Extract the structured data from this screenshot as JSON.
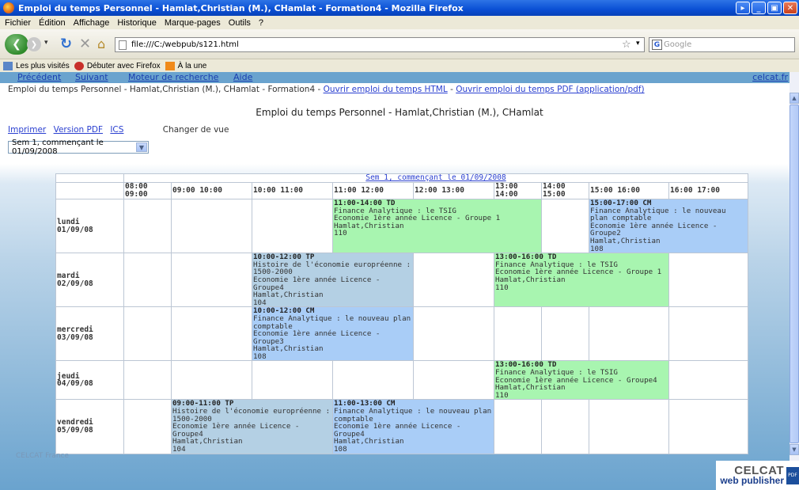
{
  "window": {
    "title": "Emploi du temps Personnel - Hamlat,Christian (M.), CHamlat - Formation4 - Mozilla Firefox"
  },
  "menu": [
    "Fichier",
    "Édition",
    "Affichage",
    "Historique",
    "Marque-pages",
    "Outils",
    "?"
  ],
  "toolbar": {
    "url": "file:///C:/webpub/s121.html",
    "search_placeholder": "Google"
  },
  "bookmarks": [
    "Les plus visités",
    "Débuter avec Firefox",
    "À la une"
  ],
  "topnav": {
    "prev": "Précédent",
    "next": "Suivant",
    "search": "Moteur de recherche",
    "help": "Aide",
    "site": "celcat.fr"
  },
  "breadcrumb": {
    "text": "Emploi du temps Personnel - Hamlat,Christian (M.), CHamlat - Formation4 - ",
    "link_html": "Ouvrir emploi du temps HTML",
    "sep": " - ",
    "link_pdf": "Ouvrir emploi du temps PDF (application/pdf)"
  },
  "page_title": "Emploi du temps Personnel - Hamlat,Christian (M.), CHamlat",
  "actions": {
    "print": "Imprimer",
    "pdf": "Version PDF",
    "ics": "ICS",
    "change_view": "Changer de vue"
  },
  "week_select": "Sem 1, commençant le 01/09/2008",
  "footer": "CELCAT France",
  "logo": {
    "line1": "CELCAT",
    "line2": "web publisher",
    "pdf": "PDF"
  },
  "timetable": {
    "week_label": "Sem 1, commençant le 01/09/2008",
    "headers": [
      "08:00 09:00",
      "09:00 10:00",
      "10:00 11:00",
      "11:00 12:00",
      "12:00 13:00",
      "13:00 14:00",
      "14:00 15:00",
      "15:00 16:00",
      "16:00 17:00"
    ],
    "days": [
      {
        "name": "lundi",
        "date": "01/09/08"
      },
      {
        "name": "mardi",
        "date": "02/09/08"
      },
      {
        "name": "mercredi",
        "date": "03/09/08"
      },
      {
        "name": "jeudi",
        "date": "04/09/08"
      },
      {
        "name": "vendredi",
        "date": "05/09/08"
      }
    ],
    "events": {
      "mon_1": {
        "time": "11:00-14:00 TD",
        "course": "Finance Analytique : le TSIG",
        "group": "Economie 1ère année Licence - Groupe 1",
        "teacher": "Hamlat,Christian",
        "room": "110"
      },
      "mon_2": {
        "time": "15:00-17:00 CM",
        "course": "Finance Analytique : le nouveau plan comptable",
        "group": "Economie 1ère année Licence - Groupe2",
        "teacher": "Hamlat,Christian",
        "room": "108"
      },
      "tue_1": {
        "time": "10:00-12:00 TP",
        "course": "Histoire de l'économie europréenne : 1500-2000",
        "group": "Economie 1ère année Licence - Groupe4",
        "teacher": "Hamlat,Christian",
        "room": "104"
      },
      "tue_2": {
        "time": "13:00-16:00 TD",
        "course": "Finance Analytique : le TSIG",
        "group": "Economie 1ère année Licence - Groupe 1",
        "teacher": "Hamlat,Christian",
        "room": "110"
      },
      "wed_1": {
        "time": "10:00-12:00 CM",
        "course": "Finance Analytique : le nouveau plan comptable",
        "group": "Economie 1ère année Licence - Groupe3",
        "teacher": "Hamlat,Christian",
        "room": "108"
      },
      "thu_1": {
        "time": "13:00-16:00 TD",
        "course": "Finance Analytique : le TSIG",
        "group": "Economie 1ère année Licence - Groupe4",
        "teacher": "Hamlat,Christian",
        "room": "110"
      },
      "fri_1": {
        "time": "09:00-11:00 TP",
        "course": "Histoire de l'économie europréenne : 1500-2000",
        "group": "Economie 1ère année Licence - Groupe4",
        "teacher": "Hamlat,Christian",
        "room": "104"
      },
      "fri_2": {
        "time": "11:00-13:00 CM",
        "course": "Finance Analytique : le nouveau plan comptable",
        "group": "Economie 1ère année Licence - Groupe4",
        "teacher": "Hamlat,Christian",
        "room": "108"
      }
    }
  },
  "colors": {
    "td": "#a8f5b0",
    "cm": "#a9cdf7",
    "tp": "#b4d0e4",
    "nav": "#6aa3ce"
  }
}
